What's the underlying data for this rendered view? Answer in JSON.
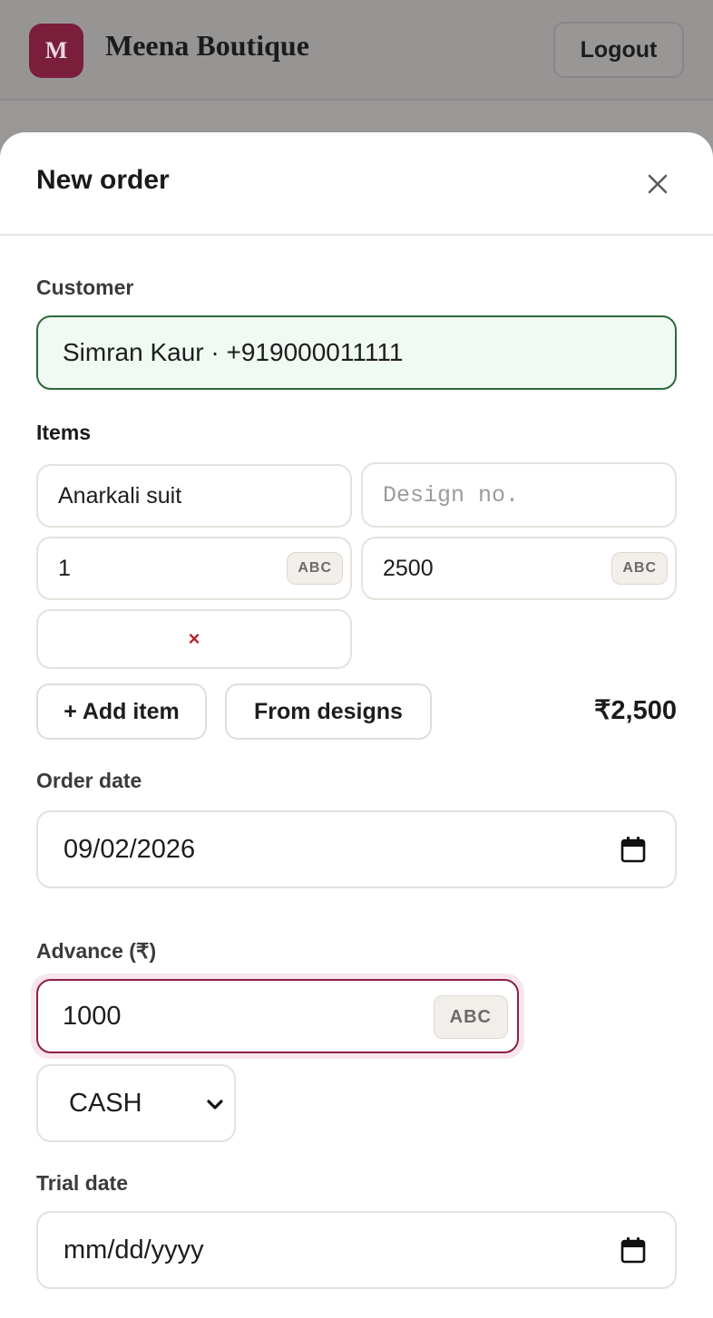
{
  "header": {
    "logo_letter": "M",
    "brand": "Meena Boutique",
    "logout_label": "Logout"
  },
  "modal": {
    "title": "New order",
    "customer_label": "Customer",
    "customer_value": "Simran Kaur · +919000011111",
    "items_label": "Items",
    "items": [
      {
        "name": "Anarkali suit",
        "design_placeholder": "Design no.",
        "qty": "1",
        "price": "2500",
        "keyboard_badge": "ABC",
        "remove_glyph": "×"
      }
    ],
    "add_item_label": "+ Add item",
    "from_designs_label": "From designs",
    "total": "₹2,500",
    "order_date_label": "Order date",
    "order_date_value": "09/02/2026",
    "advance_label": "Advance (₹)",
    "advance_value": "1000",
    "advance_badge": "ABC",
    "payment_mode": "CASH",
    "trial_date_label": "Trial date",
    "trial_date_placeholder": "mm/dd/yyyy"
  },
  "colors": {
    "brand": "#7a1e3c",
    "customer_border": "#2a6a3b",
    "customer_bg": "#f1f9f3",
    "advance_border": "#8b2048",
    "remove": "#b3262d"
  },
  "icons": {
    "close": "close-icon",
    "calendar": "calendar-icon",
    "dropdown": "chevron-down-icon",
    "remove": "remove-item-icon"
  }
}
